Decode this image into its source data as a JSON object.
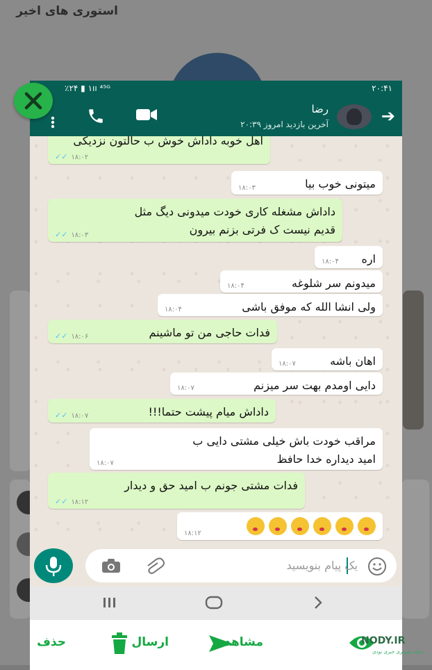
{
  "background": {
    "title": "استوری های اخیر"
  },
  "status_bar": {
    "left": "٪۲۴ ▮ ١ıı ⁴⁵ᴳ",
    "time": "۲۰:۴۱"
  },
  "chat_header": {
    "contact_name": "رضا",
    "last_seen": "آخرین بازدید امروز ۲۰:۳۹",
    "back_icon": "arrow-right-icon",
    "call_icon": "phone-icon",
    "video_icon": "video-camera-icon",
    "menu_icon": "more-vertical-icon"
  },
  "messages": [
    {
      "dir": "out",
      "lines": [
        "اهل خوبه داداش خوش ب حالتون نزدیکی"
      ],
      "time": "۱۸:۰۲"
    },
    {
      "dir": "in",
      "lines": [
        "میتونی خوب بیا"
      ],
      "time": "۱۸:۰۳"
    },
    {
      "dir": "out",
      "lines": [
        "داداش مشغله کاری خودت میدونی دیگ مثل",
        "قدیم نیست ک فرتی بزنم بیرون"
      ],
      "time": "۱۸:۰۳"
    },
    {
      "dir": "in",
      "lines": [
        "اره"
      ],
      "time": "۱۸:۰۴"
    },
    {
      "dir": "in",
      "lines": [
        "میدونم سر شلوغه"
      ],
      "time": "۱۸:۰۴"
    },
    {
      "dir": "in",
      "lines": [
        "ولی انشا الله که موفق باشی"
      ],
      "time": "۱۸:۰۴"
    },
    {
      "dir": "out",
      "lines": [
        "فدات حاجی من تو ماشینم"
      ],
      "time": "۱۸:۰۶"
    },
    {
      "dir": "in",
      "lines": [
        "اهان باشه"
      ],
      "time": "۱۸:۰۷"
    },
    {
      "dir": "in",
      "lines": [
        "دایی اومدم بهت سر میزنم"
      ],
      "time": "۱۸:۰۷"
    },
    {
      "dir": "out",
      "lines": [
        "داداش میام پیشت حتما!!!"
      ],
      "time": "۱۸:۰۷"
    },
    {
      "dir": "in",
      "lines": [
        "مراقب خودت باش خیلی مشتی دایی ب",
        "امید دیداره خدا حافظ"
      ],
      "time": "۱۸:۰۷"
    },
    {
      "dir": "out",
      "lines": [
        "فدات مشتی جونم ب امید حق و دیدار"
      ],
      "time": "۱۸:۱۲"
    },
    {
      "dir": "in",
      "lines": [],
      "emoji_count": 6,
      "time": "۱۸:۱۲"
    }
  ],
  "composer": {
    "placeholder": "یک پیام بنویسید",
    "emoji_icon": "smiley-icon",
    "attach_icon": "paperclip-icon",
    "camera_icon": "camera-icon",
    "mic_icon": "microphone-icon"
  },
  "nav_bar": {
    "recent_icon": "recent-apps-icon",
    "home_icon": "home-icon",
    "back_icon": "back-chevron-icon"
  },
  "actions": {
    "view_label": "مشاهده",
    "send_label": "ارسال",
    "delete_label": "حذف"
  },
  "watermark": {
    "text": "NODY.IR",
    "subtitle": "مجله تصویری خبری نودی"
  },
  "colors": {
    "header": "#075e54",
    "outgoing": "#dcf8c6",
    "incoming": "#ffffff",
    "accent": "#16a843"
  }
}
